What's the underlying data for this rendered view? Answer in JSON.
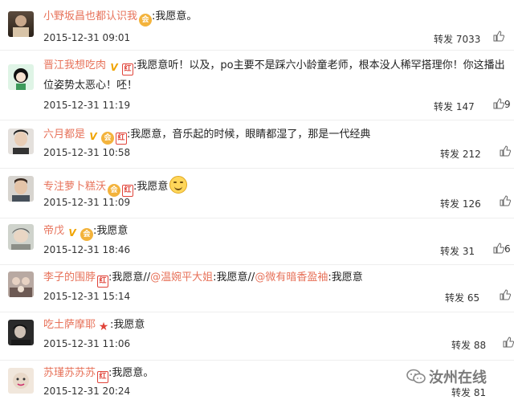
{
  "comments": [
    {
      "username": "小野坂昌也都认识我",
      "text_parts": [
        ":我愿意。"
      ],
      "time": "2015-12-31 09:01",
      "repost": "转发 7033",
      "like": ""
    },
    {
      "username": "晋江我想吃肉",
      "text_line1": ":我愿意听！以及，po主要不是踩六小龄童老师，根本没人稀罕搭理你！你这播出",
      "text_line2": "位姿势太恶心！呸！",
      "time": "2015-12-31 11:19",
      "repost": "转发 147",
      "like": "9"
    },
    {
      "username": "六月都是",
      "text": ":我愿意，音乐起的时候，眼睛都湿了，那是一代经典",
      "time": "2015-12-31 10:58",
      "repost": "转发 212",
      "like": ""
    },
    {
      "username": "专注萝卜糕沃",
      "text": ":我愿意",
      "time": "2015-12-31 11:09",
      "repost": "转发 126",
      "like": ""
    },
    {
      "username": "帝戊",
      "text": ":我愿意",
      "time": "2015-12-31 18:46",
      "repost": "转发 31",
      "like": "6"
    },
    {
      "username": "李子的围脖",
      "text_a": ":我愿意//",
      "mention_1": "@温婉平大姐",
      "text_b": ":我愿意//",
      "mention_2": "@微有暗香盈袖",
      "text_c": ":我愿意",
      "time": "2015-12-31 15:14",
      "repost": "转发 65",
      "like": ""
    },
    {
      "username": "吃土萨摩耶",
      "text": ":我愿意",
      "time": "2015-12-31 11:06",
      "repost": "转发 88",
      "like": ""
    },
    {
      "username": "苏瑾苏苏苏",
      "text": ":我愿意。",
      "time": "2015-12-31 20:24",
      "repost": "转发 81",
      "like": ""
    }
  ],
  "badges": {
    "v": "V",
    "member": "会",
    "red": "红",
    "star": "★"
  },
  "watermark": {
    "text": "汝州在线"
  },
  "colors": {
    "username": "#e7725a",
    "text": "#222222",
    "divider": "#eeeeee"
  }
}
